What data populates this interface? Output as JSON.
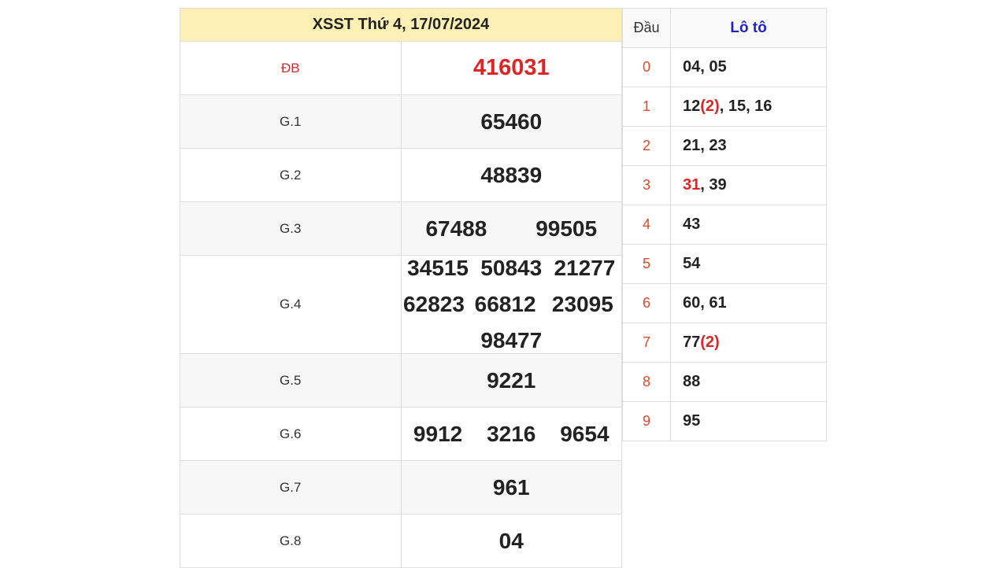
{
  "title": "XSST Thứ 4, 17/07/2024",
  "colors": {
    "header_bg": "#fdf0b4",
    "special": "#e02424",
    "loto_header": "#2222cc",
    "head_digit": "#e04a2a"
  },
  "prizes": [
    {
      "label": "ĐB",
      "numbers": [
        "416031"
      ]
    },
    {
      "label": "G.1",
      "numbers": [
        "65460"
      ]
    },
    {
      "label": "G.2",
      "numbers": [
        "48839"
      ]
    },
    {
      "label": "G.3",
      "numbers": [
        "67488",
        "99505"
      ]
    },
    {
      "label": "G.4",
      "numbers": [
        "34515",
        "50843",
        "21277",
        "62823",
        "66812",
        "23095",
        "98477"
      ]
    },
    {
      "label": "G.5",
      "numbers": [
        "9221"
      ]
    },
    {
      "label": "G.6",
      "numbers": [
        "9912",
        "3216",
        "9654"
      ]
    },
    {
      "label": "G.7",
      "numbers": [
        "961"
      ]
    },
    {
      "label": "G.8",
      "numbers": [
        "04"
      ]
    }
  ],
  "loto": {
    "header_dau": "Đầu",
    "header_loto": "Lô tô",
    "rows": [
      {
        "head": "0",
        "parts": [
          {
            "t": "04, 05",
            "hl": false
          }
        ]
      },
      {
        "head": "1",
        "parts": [
          {
            "t": "12",
            "hl": false
          },
          {
            "t": "(2)",
            "hl": true
          },
          {
            "t": ", 15, 16",
            "hl": false
          }
        ]
      },
      {
        "head": "2",
        "parts": [
          {
            "t": "21, 23",
            "hl": false
          }
        ]
      },
      {
        "head": "3",
        "parts": [
          {
            "t": "31",
            "hl": true
          },
          {
            "t": ", 39",
            "hl": false
          }
        ]
      },
      {
        "head": "4",
        "parts": [
          {
            "t": "43",
            "hl": false
          }
        ]
      },
      {
        "head": "5",
        "parts": [
          {
            "t": "54",
            "hl": false
          }
        ]
      },
      {
        "head": "6",
        "parts": [
          {
            "t": "60, 61",
            "hl": false
          }
        ]
      },
      {
        "head": "7",
        "parts": [
          {
            "t": "77",
            "hl": false
          },
          {
            "t": "(2)",
            "hl": true
          }
        ]
      },
      {
        "head": "8",
        "parts": [
          {
            "t": "88",
            "hl": false
          }
        ]
      },
      {
        "head": "9",
        "parts": [
          {
            "t": "95",
            "hl": false
          }
        ]
      }
    ]
  }
}
